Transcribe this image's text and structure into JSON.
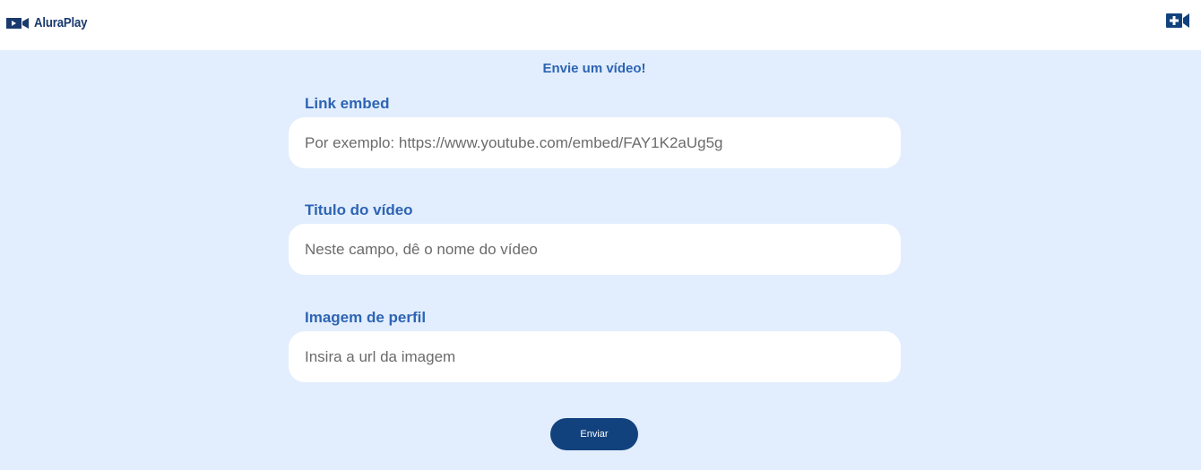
{
  "header": {
    "logo_text": "AluraPlay",
    "logo_icon": "video-camera-icon",
    "add_video_icon": "add-video-icon"
  },
  "form": {
    "title": "Envie um vídeo!",
    "fields": [
      {
        "label": "Link embed",
        "value": "",
        "placeholder": "Por exemplo: https://www.youtube.com/embed/FAY1K2aUg5g"
      },
      {
        "label": "Titulo do vídeo",
        "value": "",
        "placeholder": "Neste campo, dê o nome do vídeo"
      },
      {
        "label": "Imagem de perfil",
        "value": "",
        "placeholder": "Insira a url da imagem"
      }
    ],
    "submit_label": "Enviar"
  },
  "colors": {
    "background": "#E2EEFD",
    "header_bg": "#FFFFFF",
    "accent_text": "#2E64B4",
    "brand_dark": "#12427E"
  }
}
